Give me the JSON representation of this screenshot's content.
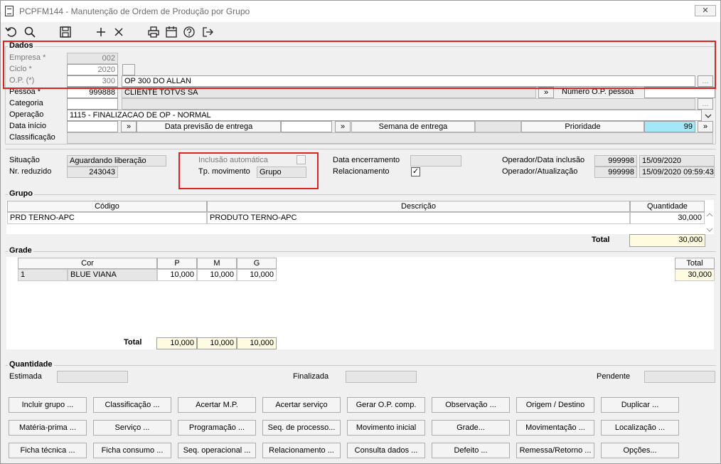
{
  "window": {
    "title": "PCPFM144 - Manutenção de Ordem de Produção por Grupo",
    "close_glyph": "✕"
  },
  "toolbar": {
    "icons": [
      "undo-icon",
      "search-icon",
      "save-icon",
      "add-icon",
      "delete-icon",
      "print-icon",
      "calendar-icon",
      "help-icon",
      "exit-icon"
    ]
  },
  "dados": {
    "legend": "Dados",
    "empresa_label": "Empresa *",
    "empresa_value": "002",
    "ciclo_label": "Ciclo *",
    "ciclo_value": "2020",
    "op_label": "O.P. (*)",
    "op_value": "300",
    "op_desc": "OP 300 DO ALLAN",
    "pessoa_label": "Pessoa *",
    "pessoa_value": "999888",
    "pessoa_desc": "CLIENTE TOTVS SA",
    "numero_op_pessoa_label": "Número O.P. pessoa",
    "numero_op_pessoa_value": "",
    "categoria_label": "Categoria",
    "categoria_value": "",
    "operacao_label": "Operação",
    "operacao_value": "1115 - FINALIZACAO DE OP - NORMAL",
    "data_inicio_label": "Data início",
    "data_inicio_value": "",
    "data_previsao_label": "Data previsão de entrega",
    "data_previsao_value": "",
    "semana_entrega_label": "Semana de entrega",
    "semana_entrega_value": "",
    "prioridade_label": "Prioridade",
    "prioridade_value": "99",
    "classificacao_label": "Classificação",
    "classificacao_value": "",
    "arrow_glyph": "»",
    "ellipsis_glyph": "..."
  },
  "status": {
    "situacao_label": "Situação",
    "situacao_value": "Aguardando liberação",
    "nr_reduzido_label": "Nr. reduzido",
    "nr_reduzido_value": "243043",
    "inclusao_auto_label": "Inclusão automática",
    "tp_movimento_label": "Tp. movimento",
    "tp_movimento_value": "Grupo",
    "data_encerramento_label": "Data encerramento",
    "data_encerramento_value": "",
    "relacionamento_label": "Relacionamento",
    "relacionamento_checked": "✓",
    "operador_inclusao_label": "Operador/Data inclusão",
    "operador_inclusao_value": "999998",
    "data_inclusao_value": "15/09/2020",
    "operador_atualizacao_label": "Operador/Atualização",
    "operador_atualizacao_value": "999998",
    "data_atualizacao_value": "15/09/2020 09:59:43"
  },
  "grupo": {
    "legend": "Grupo",
    "columns": [
      "Código",
      "Descrição",
      "Quantidade"
    ],
    "rows": [
      {
        "codigo": "PRD TERNO-APC",
        "descricao": "PRODUTO TERNO-APC",
        "quantidade": "30,000"
      }
    ],
    "total_label": "Total",
    "total_value": "30,000"
  },
  "grade": {
    "legend": "Grade",
    "columns": [
      "Cor",
      "P",
      "M",
      "G"
    ],
    "total_col": "Total",
    "rows": [
      {
        "num": "1",
        "cor": "BLUE VIANA",
        "p": "10,000",
        "m": "10,000",
        "g": "10,000",
        "total": "30,000"
      }
    ],
    "total_label": "Total",
    "totals": {
      "p": "10,000",
      "m": "10,000",
      "g": "10,000"
    }
  },
  "quantidade": {
    "legend": "Quantidade",
    "estimada_label": "Estimada",
    "estimada_value": "",
    "finalizada_label": "Finalizada",
    "finalizada_value": "",
    "pendente_label": "Pendente",
    "pendente_value": ""
  },
  "buttons": [
    [
      "Incluir grupo ...",
      "Classificação ...",
      "Acertar M.P.",
      "Acertar serviço",
      "Gerar O.P. comp.",
      "Observação ...",
      "Origem / Destino",
      "Duplicar ..."
    ],
    [
      "Matéria-prima ...",
      "Serviço ...",
      "Programação ...",
      "Seq. de processo...",
      "Movimento inicial",
      "Grade...",
      "Movimentação ...",
      "Localização ..."
    ],
    [
      "Ficha técnica ...",
      "Ficha consumo ...",
      "Seq. operacional ...",
      "Relacionamento ...",
      "Consulta dados ...",
      "Defeito ...",
      "Remessa/Retorno ...",
      "Opções..."
    ]
  ]
}
